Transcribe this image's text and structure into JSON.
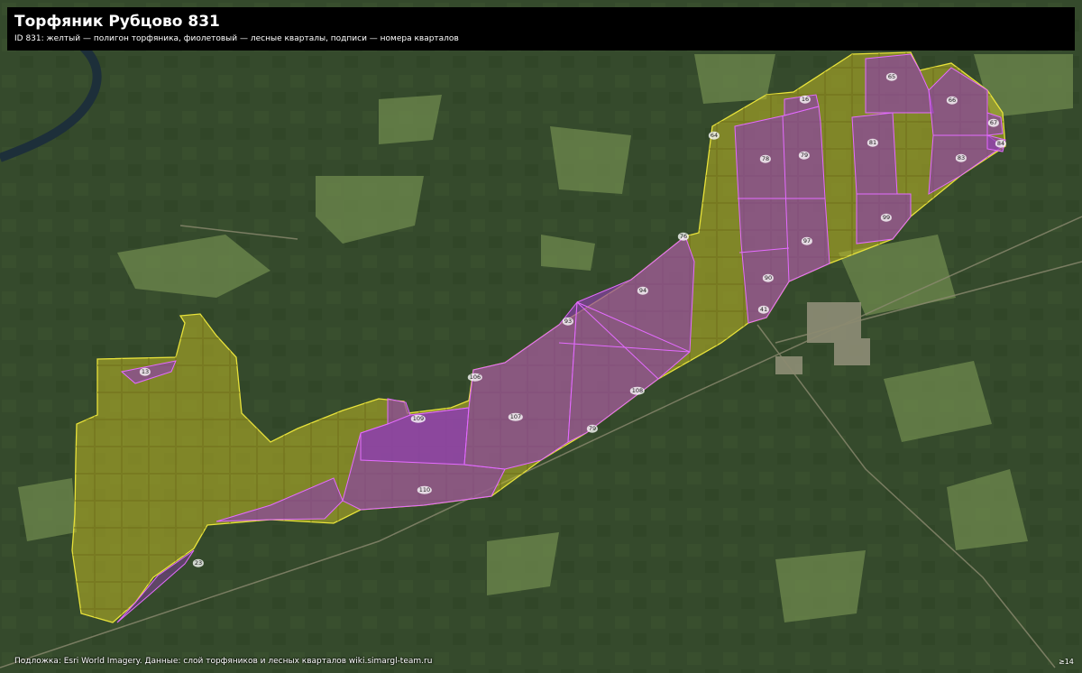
{
  "header": {
    "title": "Торфяник Рубцово 831",
    "subtitle": "ID 831: желтый — полигон торфяника, фиолетовый — лесные кварталы, подписи — номера кварталов"
  },
  "footer": {
    "attribution": "Подложка: Esri World Imagery. Данные: слой торфяников и лесных кварталов wiki.simargl-team.ru",
    "scale_note": "≥14"
  },
  "legend": {
    "peat_color": "#c9c62a",
    "quarter_color": "#9b3fb5",
    "quarter_border": "#e46bff",
    "peat_border": "#e8e23a"
  },
  "quarters": [
    {
      "id": "q13",
      "label": "13"
    },
    {
      "id": "q23",
      "label": "23"
    },
    {
      "id": "q110",
      "label": "110"
    },
    {
      "id": "q109",
      "label": "109"
    },
    {
      "id": "q106",
      "label": "106"
    },
    {
      "id": "q107",
      "label": "107"
    },
    {
      "id": "q108",
      "label": "108"
    },
    {
      "id": "q79",
      "label": "79"
    },
    {
      "id": "q93",
      "label": "93"
    },
    {
      "id": "q94",
      "label": "94"
    },
    {
      "id": "q76",
      "label": "76"
    },
    {
      "id": "q41",
      "label": "41"
    },
    {
      "id": "q90",
      "label": "90"
    },
    {
      "id": "q97",
      "label": "97"
    },
    {
      "id": "q78",
      "label": "78"
    },
    {
      "id": "q79b",
      "label": "79"
    },
    {
      "id": "q64",
      "label": "64"
    },
    {
      "id": "q16",
      "label": "16"
    },
    {
      "id": "q81",
      "label": "81"
    },
    {
      "id": "q83",
      "label": "83"
    },
    {
      "id": "q99",
      "label": "99"
    },
    {
      "id": "q65",
      "label": "65"
    },
    {
      "id": "q66",
      "label": "66"
    },
    {
      "id": "q67",
      "label": "67"
    },
    {
      "id": "q84",
      "label": "84"
    }
  ]
}
